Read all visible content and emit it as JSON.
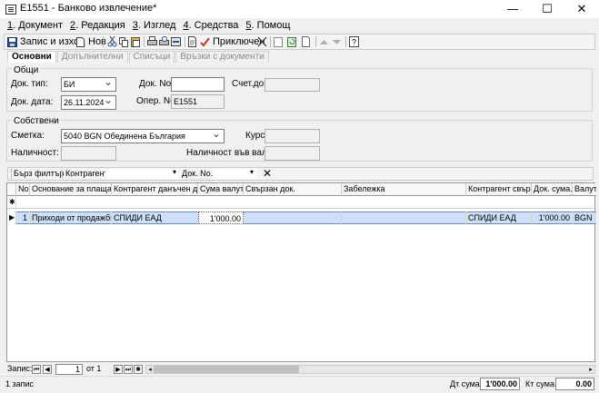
{
  "window": {
    "title": "E1551 - Банково извлечение*",
    "minimize": "—",
    "maximize": "☐",
    "close": "✕"
  },
  "menu": [
    {
      "key": "1",
      "label": ". Документ"
    },
    {
      "key": "2",
      "label": ". Редакция"
    },
    {
      "key": "3",
      "label": ". Изглед"
    },
    {
      "key": "4",
      "label": ". Средства"
    },
    {
      "key": "5",
      "label": ". Помощ"
    }
  ],
  "toolbar": {
    "save_exit": "Запис и изход",
    "new": "Нов",
    "finished": "Приключен"
  },
  "tabs": [
    {
      "label": "Основни"
    },
    {
      "label": "Допълнителни"
    },
    {
      "label": "Списъци"
    },
    {
      "label": "Връзки с документи"
    }
  ],
  "general": {
    "title": "Общи",
    "doc_type_label": "Док. тип:",
    "doc_type_value": "БИ",
    "doc_no_label": "Док. No.",
    "doc_no_value": "",
    "account_doc_label": "Счет.док.",
    "account_doc_value": "",
    "doc_date_label": "Док. дата:",
    "doc_date_value": "26.11.2024",
    "oper_no_label": "Опер. No.",
    "oper_no_value": "E1551"
  },
  "own": {
    "title": "Собствени",
    "account_label": "Сметка:",
    "account_value": "5040 BGN Обединена България",
    "rate_label": "Курс:",
    "rate_value": "",
    "available_label": "Наличност:",
    "available_value": "",
    "available_fx_label": "Наличност във валута:",
    "available_fx_value": ""
  },
  "filter": {
    "quick": "Бърз филтър",
    "contractor_label": "Контрагент:",
    "contractor_value": "",
    "doc_no_label": "Док. No.",
    "doc_no_value": ""
  },
  "grid": {
    "columns": [
      "No.",
      "Основание за плащане",
      "Контрагент данъчен док.",
      "Сума валута",
      "Свързан док.",
      "Забележка",
      "Контрагент свър...",
      "Док. сума...",
      "Валута"
    ],
    "new_row_marker": "✱",
    "current_row_marker": "▶",
    "rows": [
      [
        "1",
        "Приходи от продажби",
        "СПИДИ ЕАД",
        "1'000.00",
        "",
        "",
        "СПИДИ ЕАД",
        "1'000.00",
        "BGN"
      ]
    ]
  },
  "nav": {
    "record_label": "Запис:",
    "record_value": "1",
    "of_label": "от 1"
  },
  "status": {
    "count": "1 запис",
    "debit_label": "Дт сума:",
    "debit_value": "1'000.00",
    "credit_label": "Кт сума:",
    "credit_value": "0.00"
  }
}
